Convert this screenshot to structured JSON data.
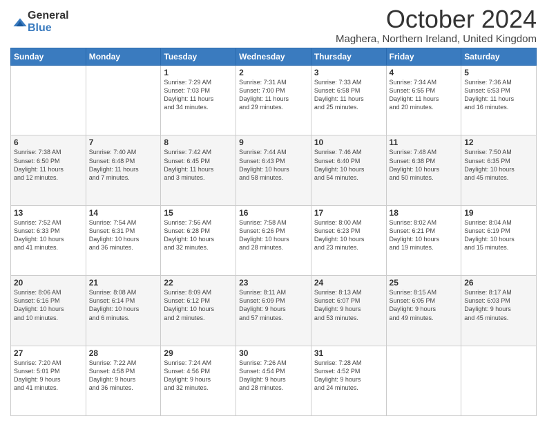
{
  "logo": {
    "general": "General",
    "blue": "Blue"
  },
  "title": "October 2024",
  "location": "Maghera, Northern Ireland, United Kingdom",
  "headers": [
    "Sunday",
    "Monday",
    "Tuesday",
    "Wednesday",
    "Thursday",
    "Friday",
    "Saturday"
  ],
  "weeks": [
    [
      {
        "day": "",
        "info": ""
      },
      {
        "day": "",
        "info": ""
      },
      {
        "day": "1",
        "info": "Sunrise: 7:29 AM\nSunset: 7:03 PM\nDaylight: 11 hours\nand 34 minutes."
      },
      {
        "day": "2",
        "info": "Sunrise: 7:31 AM\nSunset: 7:00 PM\nDaylight: 11 hours\nand 29 minutes."
      },
      {
        "day": "3",
        "info": "Sunrise: 7:33 AM\nSunset: 6:58 PM\nDaylight: 11 hours\nand 25 minutes."
      },
      {
        "day": "4",
        "info": "Sunrise: 7:34 AM\nSunset: 6:55 PM\nDaylight: 11 hours\nand 20 minutes."
      },
      {
        "day": "5",
        "info": "Sunrise: 7:36 AM\nSunset: 6:53 PM\nDaylight: 11 hours\nand 16 minutes."
      }
    ],
    [
      {
        "day": "6",
        "info": "Sunrise: 7:38 AM\nSunset: 6:50 PM\nDaylight: 11 hours\nand 12 minutes."
      },
      {
        "day": "7",
        "info": "Sunrise: 7:40 AM\nSunset: 6:48 PM\nDaylight: 11 hours\nand 7 minutes."
      },
      {
        "day": "8",
        "info": "Sunrise: 7:42 AM\nSunset: 6:45 PM\nDaylight: 11 hours\nand 3 minutes."
      },
      {
        "day": "9",
        "info": "Sunrise: 7:44 AM\nSunset: 6:43 PM\nDaylight: 10 hours\nand 58 minutes."
      },
      {
        "day": "10",
        "info": "Sunrise: 7:46 AM\nSunset: 6:40 PM\nDaylight: 10 hours\nand 54 minutes."
      },
      {
        "day": "11",
        "info": "Sunrise: 7:48 AM\nSunset: 6:38 PM\nDaylight: 10 hours\nand 50 minutes."
      },
      {
        "day": "12",
        "info": "Sunrise: 7:50 AM\nSunset: 6:35 PM\nDaylight: 10 hours\nand 45 minutes."
      }
    ],
    [
      {
        "day": "13",
        "info": "Sunrise: 7:52 AM\nSunset: 6:33 PM\nDaylight: 10 hours\nand 41 minutes."
      },
      {
        "day": "14",
        "info": "Sunrise: 7:54 AM\nSunset: 6:31 PM\nDaylight: 10 hours\nand 36 minutes."
      },
      {
        "day": "15",
        "info": "Sunrise: 7:56 AM\nSunset: 6:28 PM\nDaylight: 10 hours\nand 32 minutes."
      },
      {
        "day": "16",
        "info": "Sunrise: 7:58 AM\nSunset: 6:26 PM\nDaylight: 10 hours\nand 28 minutes."
      },
      {
        "day": "17",
        "info": "Sunrise: 8:00 AM\nSunset: 6:23 PM\nDaylight: 10 hours\nand 23 minutes."
      },
      {
        "day": "18",
        "info": "Sunrise: 8:02 AM\nSunset: 6:21 PM\nDaylight: 10 hours\nand 19 minutes."
      },
      {
        "day": "19",
        "info": "Sunrise: 8:04 AM\nSunset: 6:19 PM\nDaylight: 10 hours\nand 15 minutes."
      }
    ],
    [
      {
        "day": "20",
        "info": "Sunrise: 8:06 AM\nSunset: 6:16 PM\nDaylight: 10 hours\nand 10 minutes."
      },
      {
        "day": "21",
        "info": "Sunrise: 8:08 AM\nSunset: 6:14 PM\nDaylight: 10 hours\nand 6 minutes."
      },
      {
        "day": "22",
        "info": "Sunrise: 8:09 AM\nSunset: 6:12 PM\nDaylight: 10 hours\nand 2 minutes."
      },
      {
        "day": "23",
        "info": "Sunrise: 8:11 AM\nSunset: 6:09 PM\nDaylight: 9 hours\nand 57 minutes."
      },
      {
        "day": "24",
        "info": "Sunrise: 8:13 AM\nSunset: 6:07 PM\nDaylight: 9 hours\nand 53 minutes."
      },
      {
        "day": "25",
        "info": "Sunrise: 8:15 AM\nSunset: 6:05 PM\nDaylight: 9 hours\nand 49 minutes."
      },
      {
        "day": "26",
        "info": "Sunrise: 8:17 AM\nSunset: 6:03 PM\nDaylight: 9 hours\nand 45 minutes."
      }
    ],
    [
      {
        "day": "27",
        "info": "Sunrise: 7:20 AM\nSunset: 5:01 PM\nDaylight: 9 hours\nand 41 minutes."
      },
      {
        "day": "28",
        "info": "Sunrise: 7:22 AM\nSunset: 4:58 PM\nDaylight: 9 hours\nand 36 minutes."
      },
      {
        "day": "29",
        "info": "Sunrise: 7:24 AM\nSunset: 4:56 PM\nDaylight: 9 hours\nand 32 minutes."
      },
      {
        "day": "30",
        "info": "Sunrise: 7:26 AM\nSunset: 4:54 PM\nDaylight: 9 hours\nand 28 minutes."
      },
      {
        "day": "31",
        "info": "Sunrise: 7:28 AM\nSunset: 4:52 PM\nDaylight: 9 hours\nand 24 minutes."
      },
      {
        "day": "",
        "info": ""
      },
      {
        "day": "",
        "info": ""
      }
    ]
  ]
}
